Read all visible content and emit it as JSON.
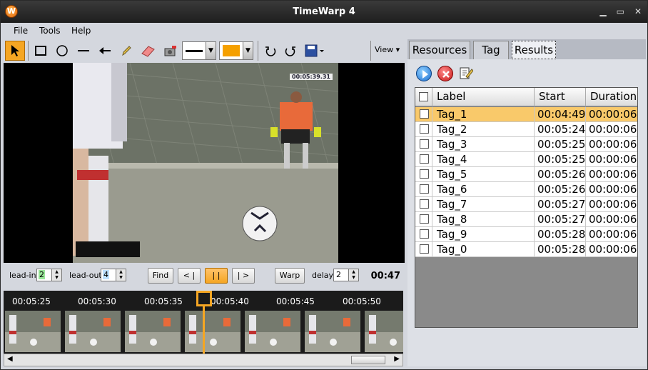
{
  "window": {
    "title": "TimeWarp 4",
    "min": "▁",
    "max": "▭",
    "close": "✕"
  },
  "menu": [
    "File",
    "Tools",
    "Help"
  ],
  "toolbar": {
    "view_label": "View",
    "line_color": "#000000",
    "fill_color": "#f5a000"
  },
  "video": {
    "timestamp": "00:05:39.31"
  },
  "controls": {
    "lead_in_label": "lead-in",
    "lead_in_value": "2",
    "lead_out_label": "lead-out",
    "lead_out_value": "4",
    "find_label": "Find",
    "prev_label": "< |",
    "pause_label": "| |",
    "next_label": "| >",
    "warp_label": "Warp",
    "delay_label": "delay",
    "delay_value": "2",
    "time": "00:47"
  },
  "timeline": {
    "ticks": [
      "00:05:25",
      "00:05:30",
      "00:05:35",
      "00:05:40",
      "00:05:45",
      "00:05:50"
    ]
  },
  "panel": {
    "tabs": [
      "Resources",
      "Tag",
      "Results"
    ],
    "selected_tab": "Results",
    "columns": [
      "Label",
      "Start",
      "Duration"
    ],
    "rows": [
      {
        "label": "Tag_1",
        "start": "00:04:49",
        "duration": "00:00:06",
        "selected": true
      },
      {
        "label": "Tag_2",
        "start": "00:05:24",
        "duration": "00:00:06"
      },
      {
        "label": "Tag_3",
        "start": "00:05:25",
        "duration": "00:00:06"
      },
      {
        "label": "Tag_4",
        "start": "00:05:25",
        "duration": "00:00:06"
      },
      {
        "label": "Tag_5",
        "start": "00:05:26",
        "duration": "00:00:06"
      },
      {
        "label": "Tag_6",
        "start": "00:05:26",
        "duration": "00:00:06"
      },
      {
        "label": "Tag_7",
        "start": "00:05:27",
        "duration": "00:00:06"
      },
      {
        "label": "Tag_8",
        "start": "00:05:27",
        "duration": "00:00:06"
      },
      {
        "label": "Tag_9",
        "start": "00:05:28",
        "duration": "00:00:06"
      },
      {
        "label": "Tag_0",
        "start": "00:05:28",
        "duration": "00:00:06"
      }
    ]
  }
}
